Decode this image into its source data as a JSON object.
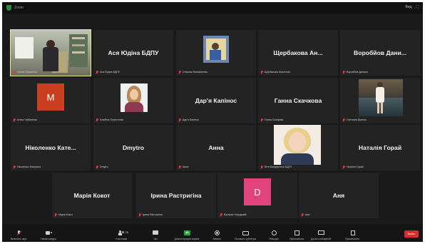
{
  "titlebar": {
    "app_title": "Zoom",
    "view_label": "Вид",
    "fullscreen_icon": "fullscreen-icon"
  },
  "tiles": [
    {
      "caption": "Ольга Юхименко",
      "kind": "video-classroom"
    },
    {
      "display_name": "Ася Юдіна БДПУ",
      "caption": "Ася Юдіна БДПУ"
    },
    {
      "caption": "Сніжана Михайленко",
      "kind": "photo-small"
    },
    {
      "display_name": "Щербакова Ан...",
      "caption": "Щербакова Анастасія"
    },
    {
      "display_name": "Воробйов Дани...",
      "caption": "Воробйов Данило"
    },
    {
      "caption": "Аліна Чабаненко",
      "avatar_letter": "M",
      "avatar_color": "#c8401f"
    },
    {
      "caption": "Альбіна Огнистенко",
      "kind": "photo-woman"
    },
    {
      "display_name": "Дар'я Капінос",
      "caption": "Дар'я Капінос"
    },
    {
      "display_name": "Ганна Скачкова",
      "caption": "Ганна Скачкова"
    },
    {
      "caption": "Світлана Шапіль",
      "kind": "photo-outdoor"
    },
    {
      "display_name": "Ніколенко Кате...",
      "caption": "Ніколенко Катерина"
    },
    {
      "display_name": "Dmytro",
      "caption": "Dmytro"
    },
    {
      "display_name": "Анна",
      "caption": "Анна"
    },
    {
      "caption": "Віта Бондаренко БДПУ",
      "kind": "photo-blonde"
    },
    {
      "display_name": "Наталія Горай",
      "caption": "Наталія Горай"
    },
    {
      "display_name": "Марія Кокот",
      "caption": "Марія Кокот"
    },
    {
      "display_name": "Ірина Растригіна",
      "caption": "Ірина Растригіна"
    },
    {
      "caption": "Валерія Неродовій",
      "avatar_letter": "D",
      "avatar_color": "#e0447a"
    },
    {
      "display_name": "Аня",
      "caption": "Аня"
    }
  ],
  "toolbar": {
    "items": [
      {
        "label": "Включить звук",
        "icon": "microphone-icon"
      },
      {
        "label": "Начать видео",
        "icon": "video-camera-icon"
      },
      {
        "label": "Участники",
        "icon": "participants-icon",
        "count": "25"
      },
      {
        "label": "Чат",
        "icon": "chat-icon"
      },
      {
        "label": "Демонстрация экрана",
        "icon": "share-screen-icon"
      },
      {
        "label": "Запись",
        "icon": "record-icon"
      },
      {
        "label": "Показать субтитры",
        "icon": "captions-icon"
      },
      {
        "label": "Реакции",
        "icon": "reactions-icon"
      },
      {
        "label": "Приложения",
        "icon": "apps-icon"
      },
      {
        "label": "Доска сообщений",
        "icon": "whiteboard-icon"
      },
      {
        "label": "Примечания",
        "icon": "notes-icon"
      }
    ],
    "end_label": "Выйти",
    "accent_colors": {
      "share_green": "#26a641",
      "end_red": "#d92b2b",
      "mute_red": "#e03a3a"
    }
  }
}
